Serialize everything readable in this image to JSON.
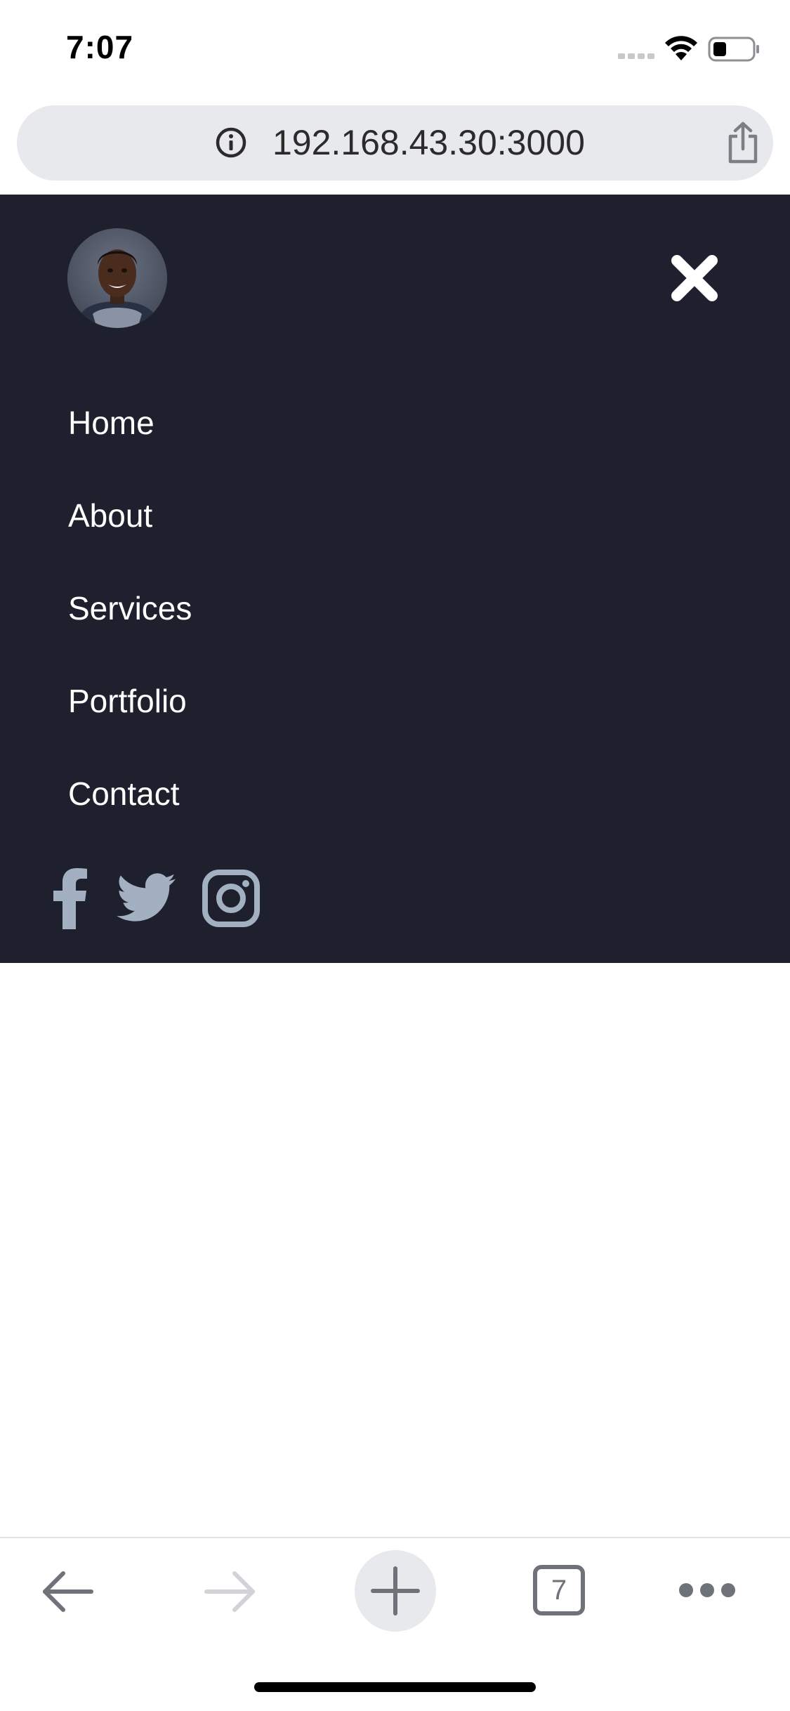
{
  "status_bar": {
    "time": "7:07",
    "icons": [
      "signal-dots-icon",
      "wifi-icon",
      "battery-icon"
    ]
  },
  "address_bar": {
    "url": "192.168.43.30:3000",
    "icons": [
      "info-icon",
      "share-icon"
    ]
  },
  "nav_menu": {
    "items": [
      {
        "label": "Home"
      },
      {
        "label": "About"
      },
      {
        "label": "Services"
      },
      {
        "label": "Portfolio"
      },
      {
        "label": "Contact"
      }
    ],
    "social": [
      "facebook-icon",
      "twitter-icon",
      "instagram-icon"
    ],
    "close_icon": "close-icon"
  },
  "toolbar": {
    "tab_count": "7",
    "icons": [
      "back-arrow-icon",
      "forward-arrow-icon",
      "plus-icon",
      "tabs-icon",
      "more-icon"
    ]
  },
  "colors": {
    "panel_bg": "#1e202d",
    "nav_text": "#ffffff",
    "social_icon": "#a3b0c2",
    "address_bar_bg": "#e8e9ec",
    "toolbar_icon": "#6f7278"
  }
}
